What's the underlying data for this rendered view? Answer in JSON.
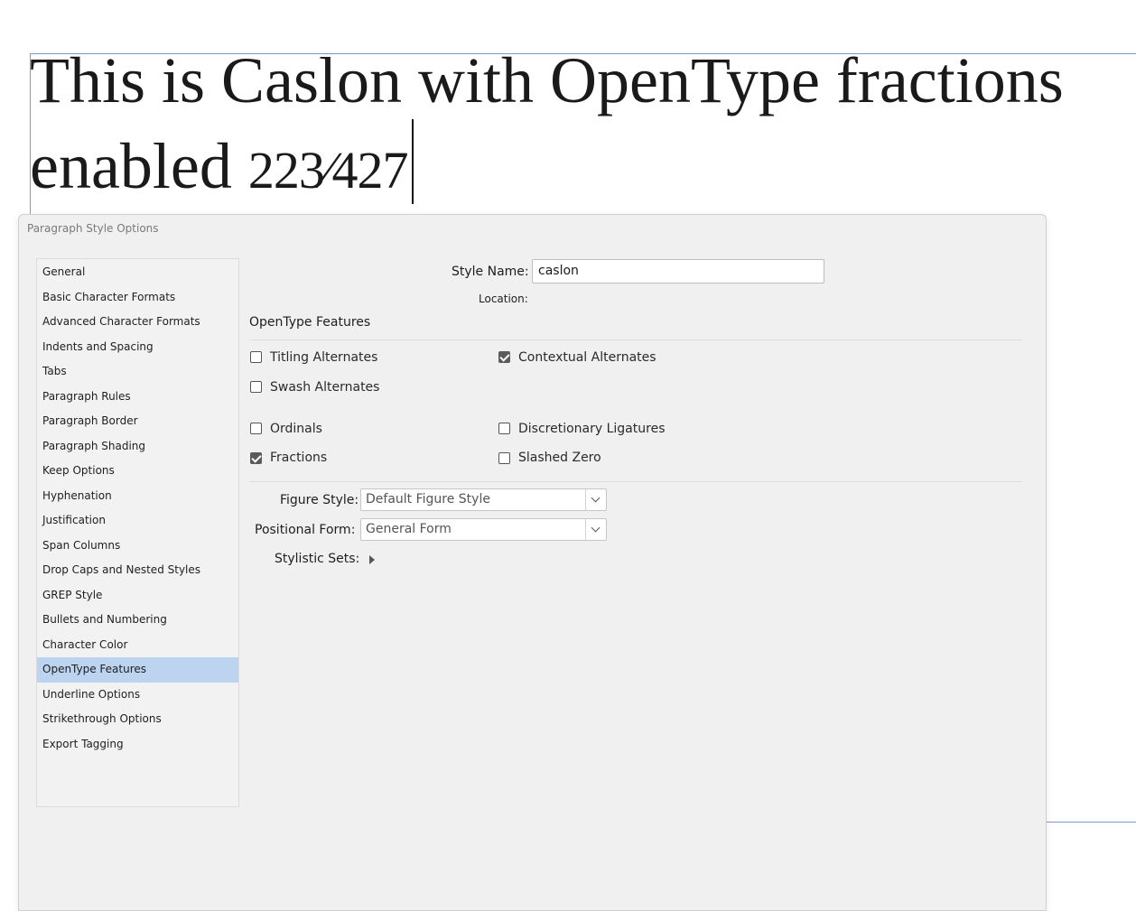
{
  "document": {
    "line1": "This is Caslon with OpenType fractions",
    "line2_prefix": "enabled ",
    "fraction": "223⁄427"
  },
  "dialog": {
    "title": "Paragraph Style Options",
    "style_name_label": "Style Name:",
    "style_name_value": "caslon",
    "location_label": "Location:",
    "section_title": "OpenType Features"
  },
  "sidebar": {
    "items": [
      {
        "label": "General"
      },
      {
        "label": "Basic Character Formats"
      },
      {
        "label": "Advanced Character Formats"
      },
      {
        "label": "Indents and Spacing"
      },
      {
        "label": "Tabs"
      },
      {
        "label": "Paragraph Rules"
      },
      {
        "label": "Paragraph Border"
      },
      {
        "label": "Paragraph Shading"
      },
      {
        "label": "Keep Options"
      },
      {
        "label": "Hyphenation"
      },
      {
        "label": "Justification"
      },
      {
        "label": "Span Columns"
      },
      {
        "label": "Drop Caps and Nested Styles"
      },
      {
        "label": "GREP Style"
      },
      {
        "label": "Bullets and Numbering"
      },
      {
        "label": "Character Color"
      },
      {
        "label": "OpenType Features"
      },
      {
        "label": "Underline Options"
      },
      {
        "label": "Strikethrough Options"
      },
      {
        "label": "Export Tagging"
      }
    ],
    "selected": "OpenType Features"
  },
  "features": {
    "titling_alternates": {
      "label": "Titling Alternates",
      "checked": false
    },
    "contextual_alternates": {
      "label": "Contextual Alternates",
      "checked": true
    },
    "swash_alternates": {
      "label": "Swash Alternates",
      "checked": false
    },
    "ordinals": {
      "label": "Ordinals",
      "checked": false
    },
    "discretionary_ligatures": {
      "label": "Discretionary Ligatures",
      "checked": false
    },
    "fractions": {
      "label": "Fractions",
      "checked": true
    },
    "slashed_zero": {
      "label": "Slashed Zero",
      "checked": false
    }
  },
  "figure_style": {
    "label": "Figure Style:",
    "value": "Default Figure Style"
  },
  "positional_form": {
    "label": "Positional Form:",
    "value": "General Form"
  },
  "stylistic_sets": {
    "label": "Stylistic Sets:"
  },
  "colors": {
    "selection": "#bcd4f0",
    "frame": "#7a9ad0"
  }
}
